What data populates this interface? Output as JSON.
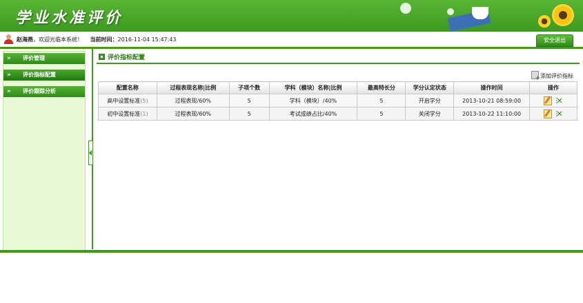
{
  "header": {
    "app_title": "学业水准评价"
  },
  "info": {
    "user_name": "赵海燕",
    "welcome": "，欢迎光临本系统！",
    "time_label": "当前时间：",
    "time_value": "2016-11-04 15:47:43",
    "logout_label": "安全退出"
  },
  "sidebar": {
    "items": [
      {
        "label": "评价管理"
      },
      {
        "label": "评价指标配置"
      },
      {
        "label": "评价跟踪分析"
      }
    ]
  },
  "main": {
    "title": "评价指标配置",
    "add_label": "添加评价指标",
    "columns": [
      "配置名称",
      "过程表现名称|比例",
      "子项个数",
      "学科（模块）名称|比例",
      "最高特长分",
      "学分认定状态",
      "操作时间",
      "操作"
    ],
    "rows": [
      {
        "name": "高中设置标准",
        "count": "(5)",
        "process": "过程表现/60%",
        "subitems": "5",
        "subject": "学科（模块）/40%",
        "max_score": "5",
        "status": "开启学分",
        "time": "2013-10-21 08:59:00"
      },
      {
        "name": "初中设置标准",
        "count": "(1)",
        "process": "过程表现/60%",
        "subitems": "5",
        "subject": "考试成绩占比/40%",
        "max_score": "5",
        "status": "关闭学分",
        "time": "2013-10-22 11:10:00"
      }
    ]
  },
  "colors": {
    "brand_green": "#3e9a1f",
    "sidebar_bg": "#e9f9d6"
  }
}
